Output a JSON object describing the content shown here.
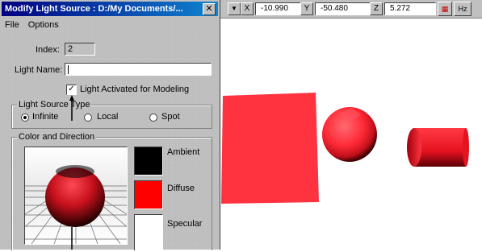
{
  "dialog": {
    "title": "Modify Light Source : D:/My Documents/...",
    "close": "✕",
    "menu": [
      "File",
      "Options"
    ],
    "index_label": "Index:",
    "index_value": "2",
    "light_name_label": "Light Name:",
    "light_name_value": "",
    "activated_label": "Light Activated for Modeling",
    "activated_checked": true,
    "source_type": {
      "title": "Light Source Type",
      "options": [
        "Infinite",
        "Local",
        "Spot"
      ],
      "selected": "Infinite"
    },
    "color_dir": {
      "title": "Color and Direction",
      "ambient_label": "Ambient",
      "diffuse_label": "Diffuse",
      "specular_label": "Specular",
      "ambient_color": "#000000",
      "diffuse_color": "#ff0000",
      "specular_color": "#ffffff"
    }
  },
  "toolbar": {
    "x_label": "X",
    "x_value": "-10.990",
    "y_label": "Y",
    "y_value": "-50.480",
    "z_label": "Z",
    "z_value": "5.272",
    "hz_label": "Hz"
  },
  "colors": {
    "object_red": "#ff3340",
    "title_blue": "#000080"
  }
}
